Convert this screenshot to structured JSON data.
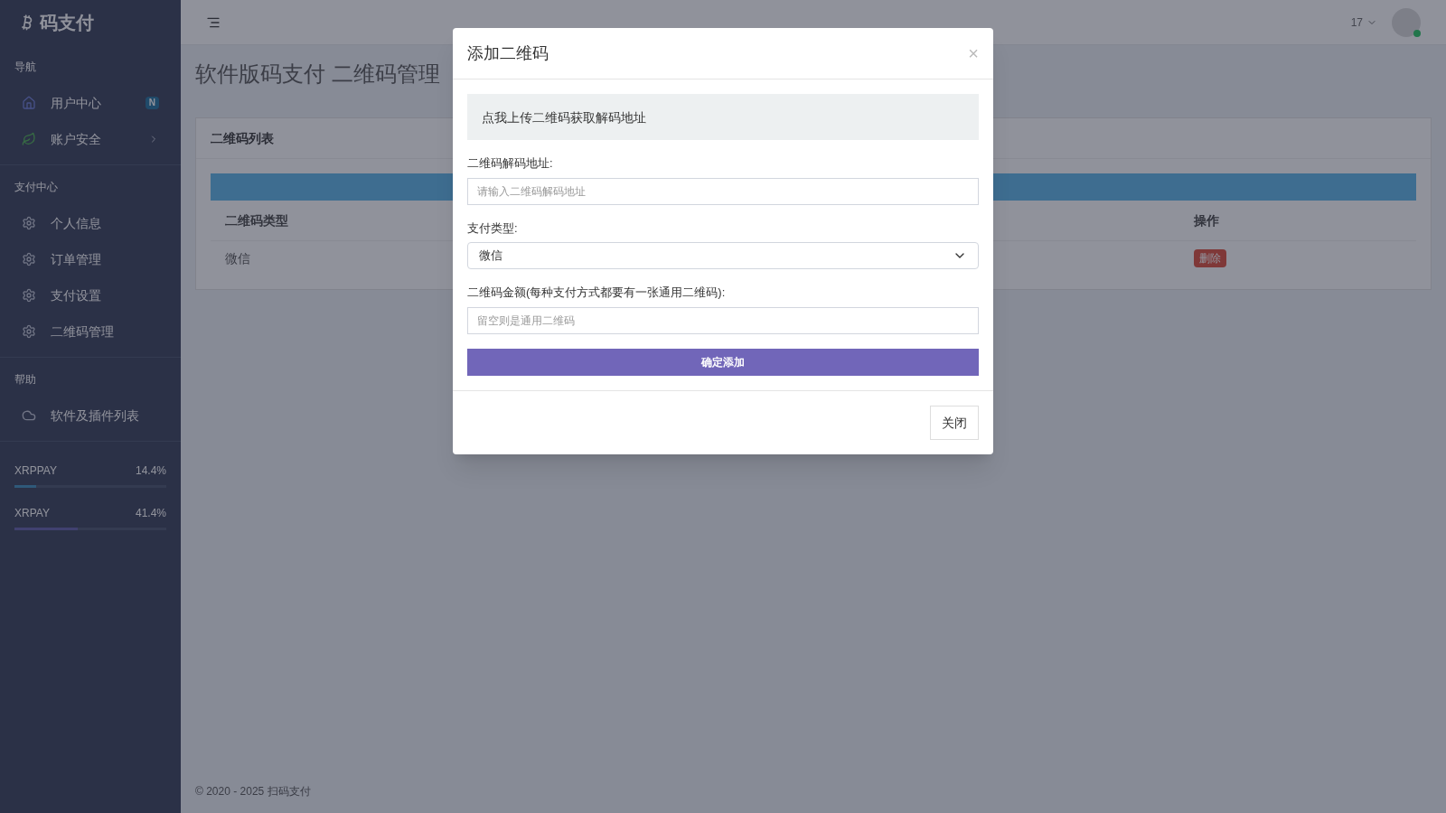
{
  "sidebar": {
    "brand": "码支付",
    "sections": [
      {
        "title": "导航",
        "items": [
          {
            "label": "用户中心",
            "badge": "N",
            "chevron": false
          },
          {
            "label": "账户安全",
            "chevron": true
          }
        ]
      },
      {
        "title": "支付中心",
        "items": [
          {
            "label": "个人信息",
            "chevron": false
          },
          {
            "label": "订单管理",
            "chevron": false
          },
          {
            "label": "支付设置",
            "chevron": false
          },
          {
            "label": "二维码管理",
            "chevron": false
          }
        ]
      },
      {
        "title": "帮助",
        "items": [
          {
            "label": "软件及插件列表",
            "chevron": false
          }
        ]
      }
    ],
    "meters": [
      {
        "name": "XRPPAY",
        "reading": "14.4%",
        "level": 0.144
      },
      {
        "name": "XRPAY",
        "reading": "41.4%",
        "level": 0.414
      }
    ]
  },
  "header": {
    "user": "17"
  },
  "page": {
    "title": "软件版码支付 二维码管理",
    "panel_title": "二维码列表",
    "table": {
      "columns": [
        "二维码类型",
        "操作"
      ],
      "rows": [
        [
          "微信",
          "删除"
        ]
      ]
    },
    "footer": "© 2020 - 2025 扫码支付"
  },
  "modal": {
    "title": "添加二维码",
    "close": "×",
    "upload": "点我上传二维码获取解码地址",
    "fields": [
      {
        "kind": "input",
        "label": "二维码解码地址:",
        "placeholder": "请输入二维码解码地址"
      },
      {
        "kind": "select",
        "label": "支付类型:",
        "value": "微信"
      },
      {
        "kind": "input",
        "label": "二维码金额(每种支付方式都要有一张通用二维码):",
        "placeholder": "留空则是通用二维码"
      }
    ],
    "submit": "确定添加",
    "dismiss": "关闭"
  }
}
